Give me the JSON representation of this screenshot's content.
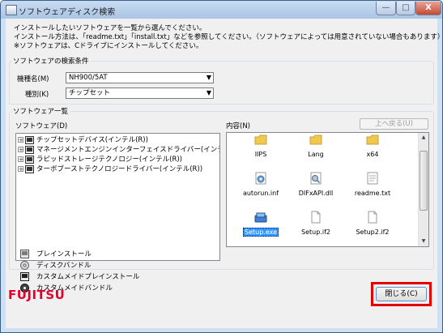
{
  "window": {
    "title": "ソフトウェアディスク検索",
    "minimize": "—",
    "maximize": "□",
    "close": "X"
  },
  "intro": [
    "インストールしたいソフトウェアを一覧から選んでください。",
    "インストール方法は、「readme.txt」「install.txt」などを参照してください。（ソフトウェアによっては用意されていない場合もあります）",
    "※ソフトウェアは、Cドライブにインストールしてください。"
  ],
  "search": {
    "legend": "ソフトウェアの検索条件",
    "model_label": "機種名(M)",
    "model_value": "NH900/5AT",
    "type_label": "種別(K)",
    "type_value": "チップセット"
  },
  "list": {
    "legend": "ソフトウェア一覧",
    "software_label": "ソフトウェア(D)",
    "contents_label": "内容(N)",
    "up_button": "上へ戻る(U)",
    "tree": [
      {
        "label": "チップセットデバイス(インテル(R))"
      },
      {
        "label": "マネージメントエンジンインターフェイスドライバー(インテル(R"
      },
      {
        "label": "ラピッドストレージテクノロジー(インテル(R))"
      },
      {
        "label": "ターボブーストテクノロジードライバー(インテル(R))"
      }
    ],
    "files": [
      {
        "name": "IIPS",
        "icon": "folder-icon"
      },
      {
        "name": "Lang",
        "icon": "folder-icon"
      },
      {
        "name": "x64",
        "icon": "folder-icon"
      },
      {
        "name": "autorun.inf",
        "icon": "settings-file-icon"
      },
      {
        "name": "DIFxAPI.dll",
        "icon": "dll-file-icon"
      },
      {
        "name": "readme.txt",
        "icon": "text-file-icon"
      },
      {
        "name": "Setup.exe",
        "icon": "setup-exe-icon"
      },
      {
        "name": "Setup.if2",
        "icon": "file-icon"
      },
      {
        "name": "Setup2.if2",
        "icon": "file-icon"
      }
    ]
  },
  "legend_items": [
    {
      "label": "プレインストール"
    },
    {
      "label": "ディスクバンドル"
    },
    {
      "label": "カスタムメイドプレインストール"
    },
    {
      "label": "カスタムメイドバンドル"
    }
  ],
  "brand": "FUJITSU",
  "close_button": "閉じる(C)",
  "colors": {
    "brand_red": "#e4002b",
    "highlight_red": "#e30000",
    "selection_blue": "#3399ff",
    "window_frame": "#cfe0f2"
  }
}
